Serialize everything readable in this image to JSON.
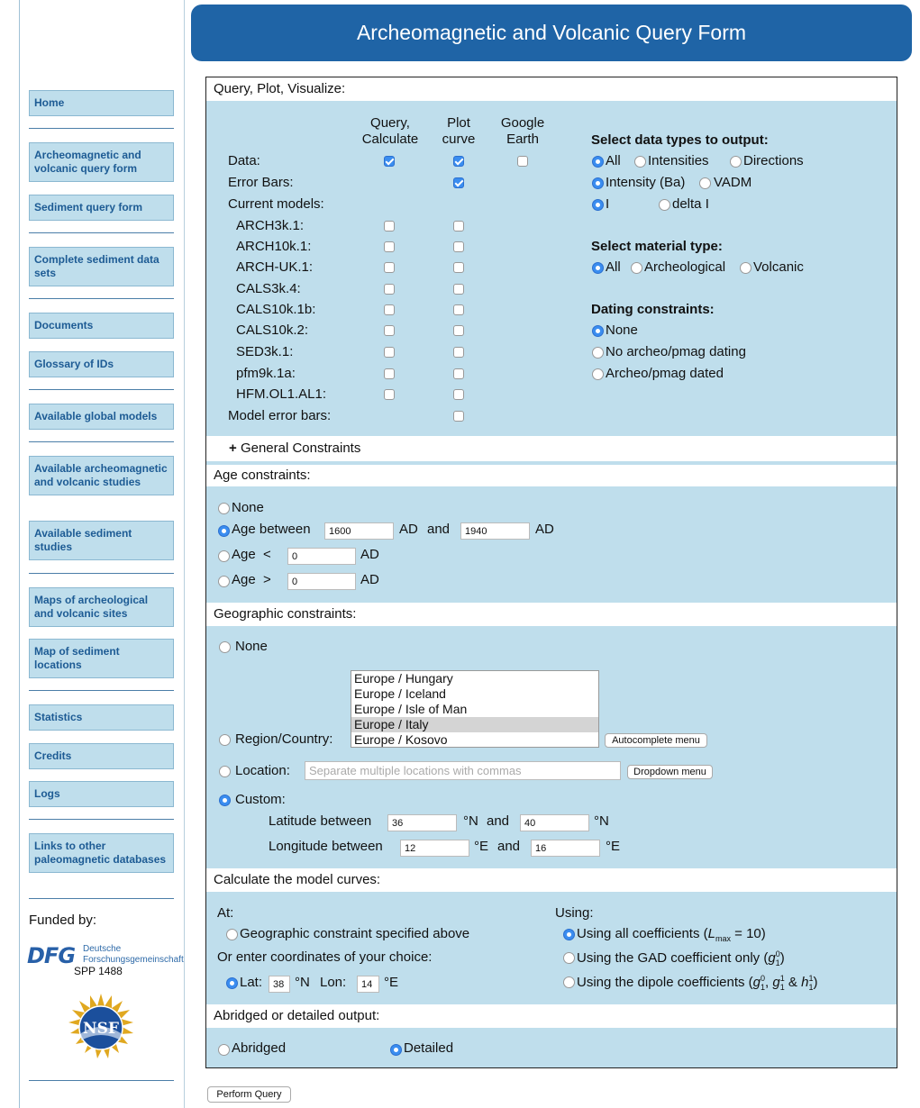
{
  "sidebar": {
    "items": [
      {
        "label": "Home"
      },
      {
        "label": "Archeomagnetic and volcanic query form"
      },
      {
        "label": "Sediment query form"
      },
      {
        "label": "Complete sediment data sets"
      },
      {
        "label": "Documents"
      },
      {
        "label": "Glossary of IDs"
      },
      {
        "label": "Available global models"
      },
      {
        "label": "Available archeomagnetic and volcanic studies"
      },
      {
        "label": "Available sediment studies"
      },
      {
        "label": "Maps of archeological and volcanic sites"
      },
      {
        "label": "Map of sediment locations"
      },
      {
        "label": "Statistics"
      },
      {
        "label": "Credits"
      },
      {
        "label": "Logs"
      },
      {
        "label": "Links to other paleomagnetic databases"
      }
    ],
    "funded_by": "Funded by:",
    "dfg_logo": "DFG",
    "dfg_name": "Deutsche Forschungsgemeinschaft",
    "spp": "SPP 1488",
    "nsf_logo": "NSF"
  },
  "header": {
    "title": "Archeomagnetic and Volcanic Query Form"
  },
  "query": {
    "section_title": "Query, Plot, Visualize:",
    "col_query": "Query, Calculate",
    "col_plot": "Plot curve",
    "col_google": "Google Earth",
    "data_label": "Data:",
    "errorbars_label": "Error Bars:",
    "current_models_label": "Current models:",
    "models": [
      "ARCH3k.1:",
      "ARCH10k.1:",
      "ARCH-UK.1:",
      "CALS3k.4:",
      "CALS10k.1b:",
      "CALS10k.2:",
      "SED3k.1:",
      "pfm9k.1a:",
      "HFM.OL1.AL1:"
    ],
    "model_errorbars_label": "Model error bars:",
    "datatypes_title": "Select data types to output:",
    "dt_all": "All",
    "dt_intensities": "Intensities",
    "dt_directions": "Directions",
    "dt_intensity_ba": "Intensity (Ba)",
    "dt_vadm": "VADM",
    "dt_i": "I",
    "dt_delta_i": "delta I",
    "material_title": "Select material type:",
    "mat_all": "All",
    "mat_archeo": "Archeological",
    "mat_volcanic": "Volcanic",
    "dating_title": "Dating constraints:",
    "dating_none": "None",
    "dating_no": "No archeo/pmag dating",
    "dating_yes": "Archeo/pmag dated",
    "general_constraints": "General Constraints",
    "general_symbol": "+"
  },
  "age": {
    "section_title": "Age constraints:",
    "none": "None",
    "between": "Age between",
    "between_from": "1600",
    "ad1": "AD",
    "and": "and",
    "between_to": "1940",
    "ad2": "AD",
    "less": "Age  <",
    "less_value": "0",
    "ad3": "AD",
    "greater": "Age  >",
    "greater_value": "0",
    "ad4": "AD"
  },
  "geo": {
    "section_title": "Geographic constraints:",
    "none": "None",
    "region_label": "Region/Country:",
    "region_options": [
      "Europe / Hungary",
      "Europe / Iceland",
      "Europe / Isle of Man",
      "Europe / Italy",
      "Europe / Kosovo"
    ],
    "autocomplete_btn": "Autocomplete menu",
    "location_label": "Location:",
    "location_placeholder": "Separate multiple locations with commas",
    "dropdown_btn": "Dropdown menu",
    "custom_label": "Custom:",
    "lat_label": "Latitude between",
    "lat_from": "36",
    "lat_unit1": "°N",
    "and": "and",
    "lat_to": "40",
    "lat_unit2": "°N",
    "lon_label": "Longitude between",
    "lon_from": "12",
    "lon_unit1": "°E",
    "lon_to": "16",
    "lon_unit2": "°E"
  },
  "curves": {
    "section_title": "Calculate the model curves:",
    "at": "At:",
    "geo_option": "Geographic constraint specified above",
    "enter_coords": "Or enter coordinates of your choice:",
    "lat": "Lat:",
    "lat_value": "38",
    "lat_unit": "°N",
    "lon": "Lon:",
    "lon_value": "14",
    "lon_unit": "°E",
    "using": "Using:",
    "all_coeffs": "Using all coefficients (",
    "lmax": "L",
    "lmax_sub": "max",
    "lmax_value": " = 10)",
    "gad": "Using the GAD coefficient only (",
    "dipole": "Using the dipole coefficients ("
  },
  "output": {
    "section_title": "Abridged or detailed output:",
    "abridged": "Abridged",
    "detailed": "Detailed"
  },
  "submit": "Perform Query"
}
